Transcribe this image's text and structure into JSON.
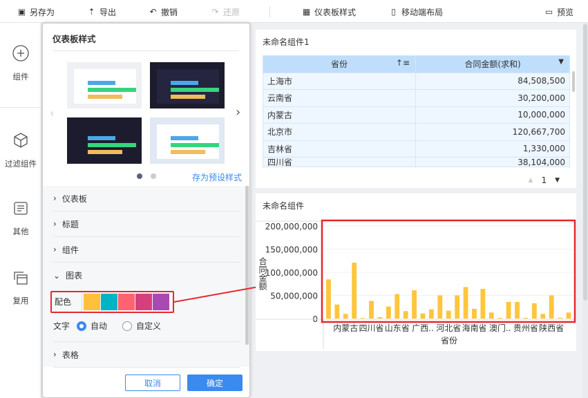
{
  "toolbar": {
    "save_as": "另存为",
    "export": "导出",
    "undo": "撤销",
    "redo": "还原",
    "dashboard_style": "仪表板样式",
    "mobile_layout": "移动端布局",
    "preview": "预览"
  },
  "sidebar": {
    "items": [
      {
        "label": "组件"
      },
      {
        "label": "过滤组件"
      },
      {
        "label": "其他"
      },
      {
        "label": "复用"
      }
    ]
  },
  "panel": {
    "title": "仪表板样式",
    "save_preset": "存为预设样式",
    "page_dots": {
      "current": 1,
      "total": 2
    },
    "sections": [
      {
        "label": "仪表板"
      },
      {
        "label": "标题"
      },
      {
        "label": "组件"
      },
      {
        "label": "图表"
      },
      {
        "label": "表格"
      }
    ],
    "color_label": "配色",
    "palette": [
      "#ffc03c",
      "#00b4c3",
      "#ff6370",
      "#d63f7d",
      "#a84ab1"
    ],
    "text_label": "文字",
    "text_options": [
      {
        "label": "自动",
        "selected": true
      },
      {
        "label": "自定义",
        "selected": false
      }
    ],
    "cancel": "取消",
    "ok": "确定"
  },
  "table_widget": {
    "title": "未命名组件1",
    "headers": [
      "省份",
      "合同金额(求和)"
    ],
    "rows": [
      [
        "上海市",
        "84,508,500"
      ],
      [
        "云南省",
        "30,200,000"
      ],
      [
        "内蒙古",
        "10,000,000"
      ],
      [
        "北京市",
        "120,667,700"
      ],
      [
        "吉林省",
        "1,330,000"
      ],
      [
        "四川省",
        "38,104,000"
      ]
    ],
    "page": "1"
  },
  "chart_widget": {
    "title": "未命名组件"
  },
  "chart_data": {
    "type": "bar",
    "title": "未命名组件",
    "xlabel": "省份",
    "ylabel": "合同金额",
    "ylim": [
      0,
      200000000
    ],
    "yticks": [
      "0",
      "50,000,000",
      "100,000,000",
      "150,000,000",
      "200,000,000"
    ],
    "xtick_labels": [
      {
        "index": 2,
        "label": "内蒙古"
      },
      {
        "index": 5,
        "label": "四川省"
      },
      {
        "index": 8,
        "label": "山东省"
      },
      {
        "index": 11,
        "label": "广西.."
      },
      {
        "index": 14,
        "label": "河北省"
      },
      {
        "index": 17,
        "label": "海南省"
      },
      {
        "index": 20,
        "label": "澳门.."
      },
      {
        "index": 23,
        "label": "贵州省"
      },
      {
        "index": 26,
        "label": "陕西省"
      }
    ],
    "values": [
      84508500,
      30200000,
      10000000,
      120667700,
      1330000,
      38104000,
      3000000,
      26000000,
      53000000,
      16000000,
      61000000,
      11000000,
      20000000,
      50000000,
      17000000,
      50000000,
      68000000,
      21000000,
      64000000,
      13000000,
      1500000,
      36000000,
      36000000,
      1500000,
      33000000,
      10000000,
      50000000,
      1500000,
      13000000
    ],
    "color": "#ffc53d"
  }
}
